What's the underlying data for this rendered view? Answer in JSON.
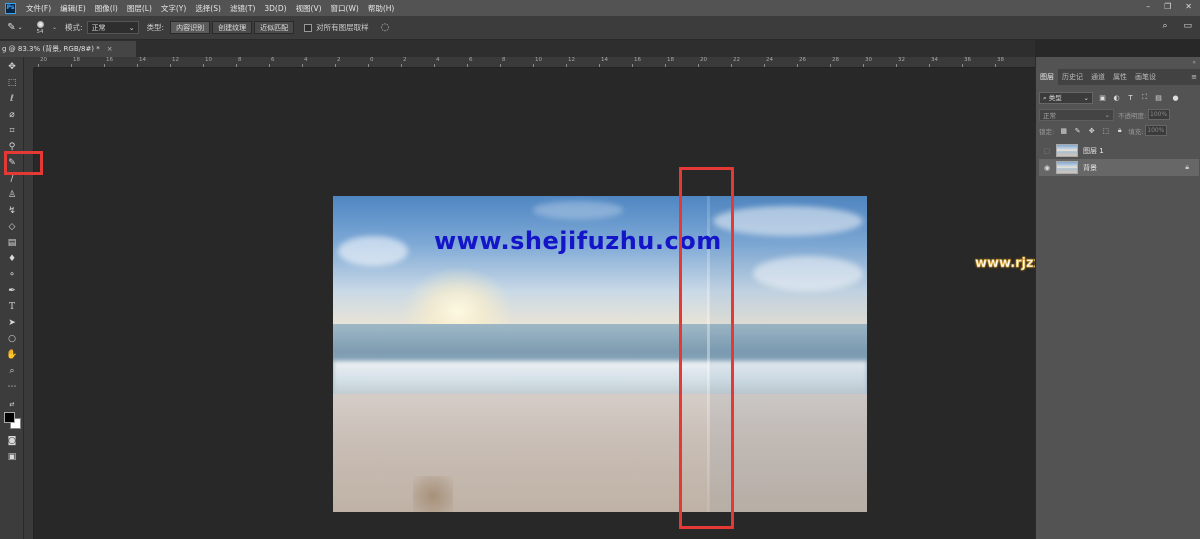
{
  "app": {
    "logo": "Ps"
  },
  "menu": [
    "文件(F)",
    "编辑(E)",
    "图像(I)",
    "图层(L)",
    "文字(Y)",
    "选择(S)",
    "滤镜(T)",
    "3D(D)",
    "视图(V)",
    "窗口(W)",
    "帮助(H)"
  ],
  "options": {
    "brush_size": "54",
    "mode_label": "模式:",
    "mode_value": "正常",
    "type_label": "类型:",
    "type_buttons": [
      "内容识别",
      "创建纹理",
      "近似匹配"
    ],
    "sample_all_layers": "对所有图层取样"
  },
  "document": {
    "tab_title": "g @ 83.3% (背景, RGB/8#) *",
    "close": "×"
  },
  "ruler": {
    "labels": [
      "20",
      "18",
      "16",
      "14",
      "12",
      "10",
      "8",
      "6",
      "4",
      "2",
      "0",
      "2",
      "4",
      "6",
      "8",
      "10",
      "12",
      "14",
      "16",
      "18",
      "20",
      "22",
      "24",
      "26",
      "28",
      "30",
      "32",
      "34",
      "36",
      "38"
    ]
  },
  "watermarks": {
    "main": "www.shejifuzhu.com",
    "secondary": "www.rjzxw.net"
  },
  "panel": {
    "tabs": [
      "图层",
      "历史记",
      "通道",
      "属性",
      "画笔设"
    ],
    "filter_kind": "类型",
    "blend_mode": "正常",
    "opacity_label": "不透明度:",
    "opacity_value": "100%",
    "lock_label": "锁定:",
    "fill_label": "填充:",
    "fill_value": "100%",
    "layers": [
      {
        "name": "图层 1",
        "visible": false,
        "locked": false
      },
      {
        "name": "背景",
        "visible": true,
        "locked": true
      }
    ]
  },
  "colors": {
    "highlight_red": "#e53935",
    "watermark_blue": "#1414c8"
  }
}
